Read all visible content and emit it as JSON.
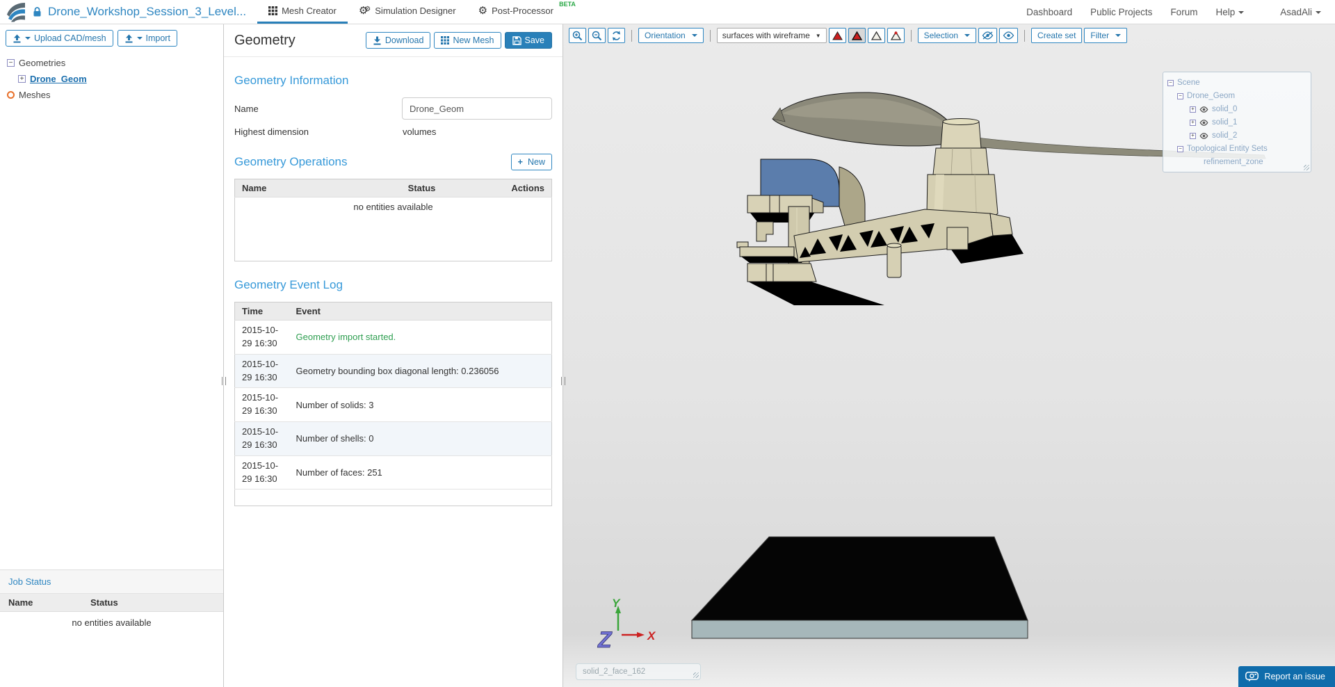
{
  "navbar": {
    "project_title": "Drone_Workshop_Session_3_Level...",
    "tabs": [
      {
        "label": "Mesh Creator",
        "active": true
      },
      {
        "label": "Simulation Designer",
        "active": false
      },
      {
        "label": "Post-Processor",
        "active": false,
        "badge": "BETA"
      }
    ],
    "links": {
      "dashboard": "Dashboard",
      "public_projects": "Public Projects",
      "forum": "Forum",
      "help": "Help"
    },
    "user_name": "AsadAli"
  },
  "sidebar": {
    "upload_button": "Upload CAD/mesh",
    "import_button": "Import",
    "tree": {
      "geometries_label": "Geometries",
      "geometry_item": "Drone_Geom",
      "meshes_label": "Meshes"
    },
    "job_status": {
      "title": "Job Status",
      "col_name": "Name",
      "col_status": "Status",
      "empty_text": "no entities available"
    }
  },
  "main": {
    "title": "Geometry",
    "buttons": {
      "download": "Download",
      "new_mesh": "New Mesh",
      "save": "Save"
    },
    "info": {
      "heading": "Geometry Information",
      "name_label": "Name",
      "name_value": "Drone_Geom",
      "dim_label": "Highest dimension",
      "dim_value": "volumes"
    },
    "operations": {
      "heading": "Geometry Operations",
      "new_button": "New",
      "col_name": "Name",
      "col_status": "Status",
      "col_actions": "Actions",
      "empty_text": "no entities available"
    },
    "event_log": {
      "heading": "Geometry Event Log",
      "col_time": "Time",
      "col_event": "Event",
      "rows": [
        {
          "time": "2015-10-29 16:30",
          "event": "Geometry import started."
        },
        {
          "time": "2015-10-29 16:30",
          "event": "Geometry bounding box diagonal length: 0.236056"
        },
        {
          "time": "2015-10-29 16:30",
          "event": "Number of solids: 3"
        },
        {
          "time": "2015-10-29 16:30",
          "event": "Number of shells: 0"
        },
        {
          "time": "2015-10-29 16:30",
          "event": "Number of faces: 251"
        }
      ]
    }
  },
  "viewport": {
    "toolbar": {
      "orientation": "Orientation",
      "render_mode": "surfaces with wireframe",
      "selection": "Selection",
      "create_set": "Create set",
      "filter": "Filter"
    },
    "scene_tree": {
      "root": "Scene",
      "geometry": "Drone_Geom",
      "solids": [
        "solid_0",
        "solid_1",
        "solid_2"
      ],
      "entity_sets_label": "Topological Entity Sets",
      "entity_set": "refinement_zone"
    },
    "axis": {
      "x": "X",
      "y": "Y",
      "z": "Z"
    },
    "hover_label": "solid_2_face_162",
    "report_button": "Report an issue"
  },
  "colors": {
    "accent_blue": "#2980b9",
    "link_blue": "#2e86c1",
    "heading_blue": "#3699d9",
    "beta_green": "#27a744",
    "event_green": "#2e9e50",
    "model_khaki": "#d5cfb2",
    "model_blue": "#5b7dac",
    "propeller_gray": "#8d8b7a",
    "ground_black": "#050505",
    "ground_side_gray": "#a6b7ba",
    "axis_x_red": "#cc2222",
    "axis_y_green": "#3aa53a",
    "axis_z_purple": "#7171d2"
  }
}
